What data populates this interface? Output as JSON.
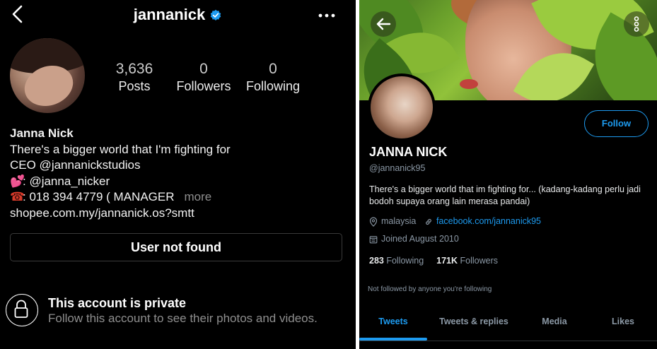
{
  "instagram": {
    "username": "jannanick",
    "stats": [
      {
        "value": "3,636",
        "label": "Posts"
      },
      {
        "value": "0",
        "label": "Followers"
      },
      {
        "value": "0",
        "label": "Following"
      }
    ],
    "bio": {
      "name": "Janna Nick",
      "lines": [
        "There's a bigger world that I'm fighting for",
        "CEO @jannanickstudios",
        ": @janna_nicker",
        ":  018 394 4779 ( MANAGER",
        "shopee.com.my/jannanick.os?smtt"
      ],
      "more": "more"
    },
    "button": "User not found",
    "private_title": "This account is private",
    "private_sub": "Follow this account to see their photos and videos.",
    "colors": {
      "background": "#000000",
      "verified": "#1d9bf0",
      "muted": "#8e8e8e"
    }
  },
  "twitter": {
    "name": "JANNA NICK",
    "handle": "@jannanick95",
    "bio": "There's a bigger world that im fighting for... (kadang-kadang perlu jadi bodoh supaya orang lain merasa pandai)",
    "location": "malaysia",
    "link": "facebook.com/jannanick95",
    "joined": "Joined August 2010",
    "following_count": "283",
    "following_label": "Following",
    "followers_count": "171K",
    "followers_label": "Followers",
    "follow_button": "Follow",
    "not_followed": "Not followed by anyone you're following",
    "tabs": [
      "Tweets",
      "Tweets & replies",
      "Media",
      "Likes"
    ],
    "active_tab": "Tweets",
    "colors": {
      "accent": "#1d9bf0",
      "muted": "#8b98a5",
      "background": "#000000"
    }
  }
}
